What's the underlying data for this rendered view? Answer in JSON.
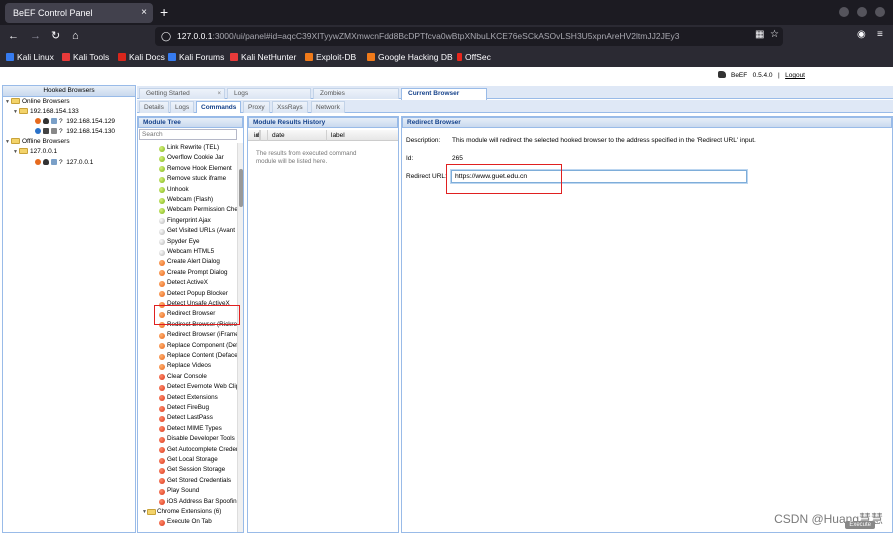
{
  "browser": {
    "tab_title": "BeEF Control Panel",
    "tab_close": "×",
    "new_tab": "+",
    "url_host": "127.0.0.1",
    "url_rest": ":3000/ui/panel#id=aqcC39XITyywZMXmwcnFdd8BcDPTfcva0wBtpXNbuLKCE76eSCkASOvLSH3U5xpnAreHV2ltmJJ2JEy3",
    "bookmarks": [
      "Kali Linux",
      "Kali Tools",
      "Kali Docs",
      "Kali Forums",
      "Kali NetHunter",
      "Exploit-DB",
      "Google Hacking DB",
      "OffSec"
    ]
  },
  "header": {
    "product": "BeEF",
    "version": "0.5.4.0",
    "separator": "|",
    "logout": "Logout"
  },
  "hooked": {
    "title": "Hooked Browsers",
    "online_label": "Online Browsers",
    "online_host": "192.168.154.133",
    "online_ip1": "192.168.154.129",
    "online_ip2": "192.168.154.130",
    "offline_label": "Offline Browsers",
    "offline_host": "127.0.0.1",
    "offline_ip": "127.0.0.1",
    "unknown_mark": "?"
  },
  "main_tabs": [
    "Getting Started",
    "Logs",
    "Zombies",
    "Current Browser"
  ],
  "sub_tabs": [
    "Details",
    "Logs",
    "Commands",
    "Proxy",
    "XssRays",
    "Network"
  ],
  "module_tree": {
    "title": "Module Tree",
    "search_placeholder": "Search",
    "items": [
      {
        "label": "Link Rewrite (TEL)",
        "status": "green"
      },
      {
        "label": "Overflow Cookie Jar",
        "status": "green"
      },
      {
        "label": "Remove Hook Element",
        "status": "green"
      },
      {
        "label": "Remove stuck iframe",
        "status": "green"
      },
      {
        "label": "Unhook",
        "status": "green"
      },
      {
        "label": "Webcam (Flash)",
        "status": "green"
      },
      {
        "label": "Webcam Permission Che",
        "status": "green"
      },
      {
        "label": "Fingerprint Ajax",
        "status": "gray"
      },
      {
        "label": "Get Visited URLs (Avant I",
        "status": "gray"
      },
      {
        "label": "Spyder Eye",
        "status": "gray"
      },
      {
        "label": "Webcam HTML5",
        "status": "gray"
      },
      {
        "label": "Create Alert Dialog",
        "status": "orange"
      },
      {
        "label": "Create Prompt Dialog",
        "status": "orange"
      },
      {
        "label": "Detect ActiveX",
        "status": "orange"
      },
      {
        "label": "Detect Popup Blocker",
        "status": "orange"
      },
      {
        "label": "Detect Unsafe ActiveX",
        "status": "orange"
      },
      {
        "label": "Redirect Browser",
        "status": "orange"
      },
      {
        "label": "Redirect Browser (Rickrol",
        "status": "orange"
      },
      {
        "label": "Redirect Browser (iFrame",
        "status": "orange"
      },
      {
        "label": "Replace Component (Def",
        "status": "orange"
      },
      {
        "label": "Replace Content (Deface",
        "status": "orange"
      },
      {
        "label": "Replace Videos",
        "status": "orange"
      },
      {
        "label": "Clear Console",
        "status": "red"
      },
      {
        "label": "Detect Evernote Web Clip",
        "status": "red"
      },
      {
        "label": "Detect Extensions",
        "status": "red"
      },
      {
        "label": "Detect FireBug",
        "status": "red"
      },
      {
        "label": "Detect LastPass",
        "status": "red"
      },
      {
        "label": "Detect MIME Types",
        "status": "red"
      },
      {
        "label": "Disable Developer Tools",
        "status": "red"
      },
      {
        "label": "Get Autocomplete Creder",
        "status": "red"
      },
      {
        "label": "Get Local Storage",
        "status": "red"
      },
      {
        "label": "Get Session Storage",
        "status": "red"
      },
      {
        "label": "Get Stored Credentials",
        "status": "red"
      },
      {
        "label": "Play Sound",
        "status": "red"
      },
      {
        "label": "iOS Address Bar Spoofin",
        "status": "red"
      },
      {
        "label": "Chrome Extensions (6)",
        "status": "folder"
      },
      {
        "label": "Execute On Tab",
        "status": "red"
      }
    ]
  },
  "results": {
    "title": "Module Results History",
    "col_id": "id",
    "col_sort": "▲",
    "col_date": "date",
    "col_label": "label",
    "empty_text": "The results from executed command module will be listed here."
  },
  "redirect": {
    "title": "Redirect Browser",
    "desc_label": "Description:",
    "desc_value": "This module will redirect the selected hooked browser to the address specified in the 'Redirect URL' input.",
    "id_label": "Id:",
    "id_value": "265",
    "url_label": "Redirect URL:",
    "url_value": "https://www.guet.edu.cn"
  },
  "watermark": "CSDN @Huang慧慧",
  "execute_label": "Execute"
}
